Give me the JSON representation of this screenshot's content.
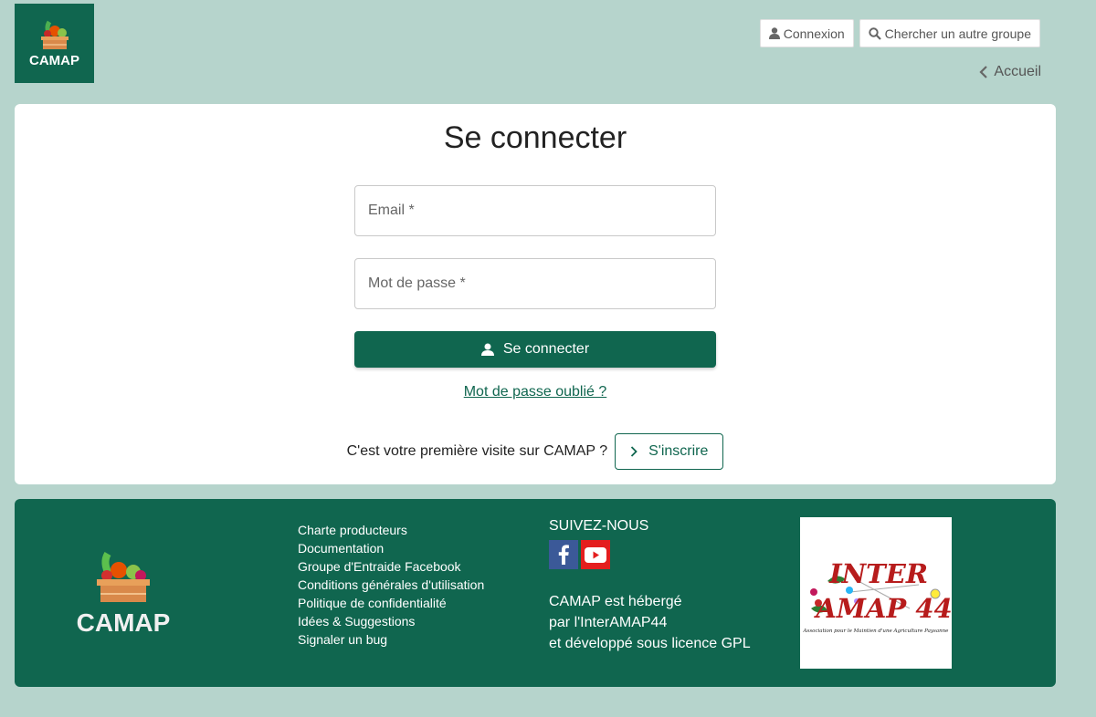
{
  "header": {
    "logo_text": "CAMAP",
    "login_label": "Connexion",
    "search_group_label": "Chercher un autre groupe",
    "back_label": "Accueil"
  },
  "login": {
    "title": "Se connecter",
    "email_placeholder": "Email *",
    "password_placeholder": "Mot de passe *",
    "submit_label": "Se connecter",
    "forgot_label": "Mot de passe oublié ?",
    "first_visit_text": "C'est votre première visite sur CAMAP ?",
    "signup_label": "S'inscrire"
  },
  "footer": {
    "logo_text": "CAMAP",
    "links": [
      "Charte producteurs",
      "Documentation",
      "Groupe d'Entraide Facebook",
      "Conditions générales d'utilisation",
      "Politique de confidentialité",
      "Idées & Suggestions",
      "Signaler un bug"
    ],
    "follow_title": "SUIVEZ-NOUS",
    "social": [
      "facebook-icon",
      "youtube-icon"
    ],
    "host_lines": [
      "CAMAP est hébergé",
      "par l'InterAMAP44",
      "et développé sous licence GPL"
    ],
    "partner_logo_line1": "INTER",
    "partner_logo_line2": "AMAP 44",
    "partner_logo_tagline": "Association pour le Maintien d'une Agriculture Paysanne"
  },
  "colors": {
    "brand": "#10664f",
    "background": "#b6d4cc"
  }
}
